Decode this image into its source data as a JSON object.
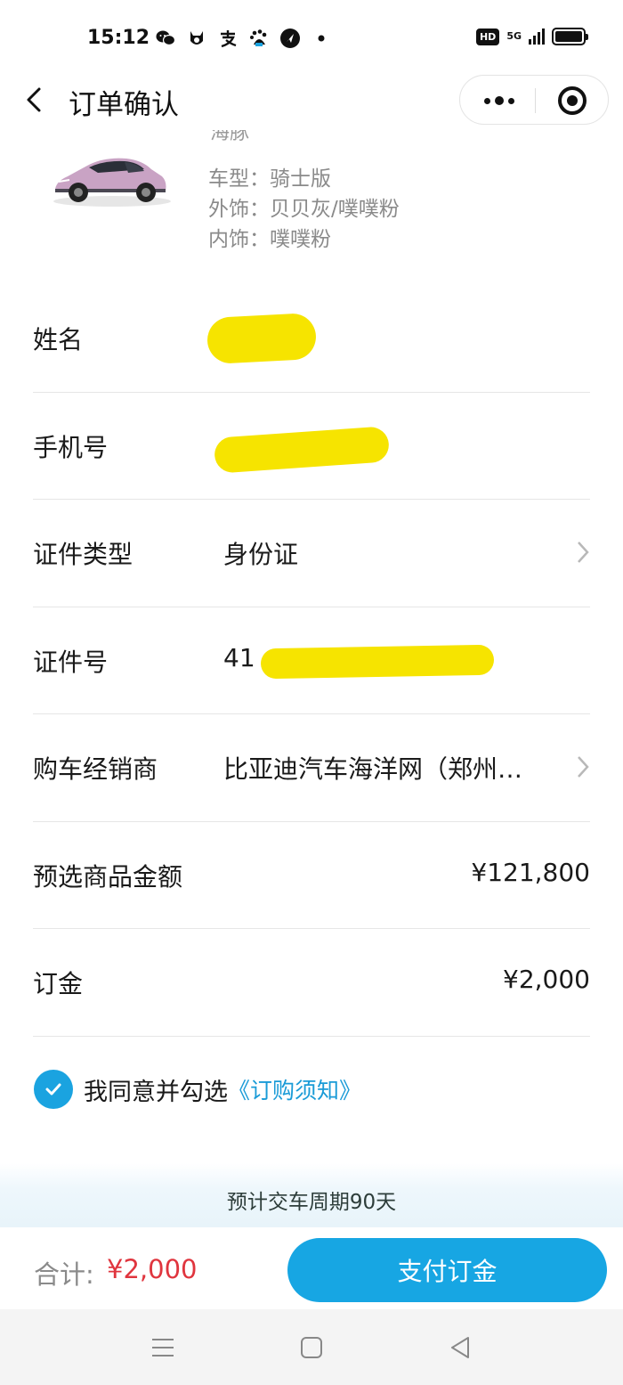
{
  "status_bar": {
    "time": "15:12",
    "icons": [
      "wechat-icon",
      "app-icon",
      "alipay-icon",
      "baidu-icon",
      "location-app-icon",
      "dot-icon"
    ],
    "hd": "HD",
    "network": "5G"
  },
  "nav": {
    "title": "订单确认"
  },
  "car": {
    "clipped_title": "海豚",
    "specs": [
      {
        "label": "车型：",
        "value": "骑士版"
      },
      {
        "label": "外饰：",
        "value": "贝贝灰/噗噗粉"
      },
      {
        "label": "内饰：",
        "value": "噗噗粉"
      }
    ],
    "color": "#c9a3c4"
  },
  "form": {
    "name": {
      "label": "姓名",
      "value": ""
    },
    "phone": {
      "label": "手机号",
      "value": ""
    },
    "id_type": {
      "label": "证件类型",
      "value": "身份证"
    },
    "id_number": {
      "label": "证件号",
      "value": "41"
    },
    "dealer": {
      "label": "购车经销商",
      "value": "比亚迪汽车海洋网（郑州…"
    },
    "price": {
      "label": "预选商品金额",
      "value": "¥121,800"
    },
    "deposit": {
      "label": "订金",
      "value": "¥2,000"
    }
  },
  "agreement": {
    "text": "我同意并勾选",
    "link": "《订购须知》",
    "checked": true
  },
  "delivery": {
    "text": "预计交车周期90天"
  },
  "bottom": {
    "total_label": "合计:",
    "total_value": "¥2,000",
    "pay_label": "支付订金"
  },
  "colors": {
    "accent": "#17a6e3",
    "price_red": "#e0353e",
    "redaction": "#f6e400"
  }
}
